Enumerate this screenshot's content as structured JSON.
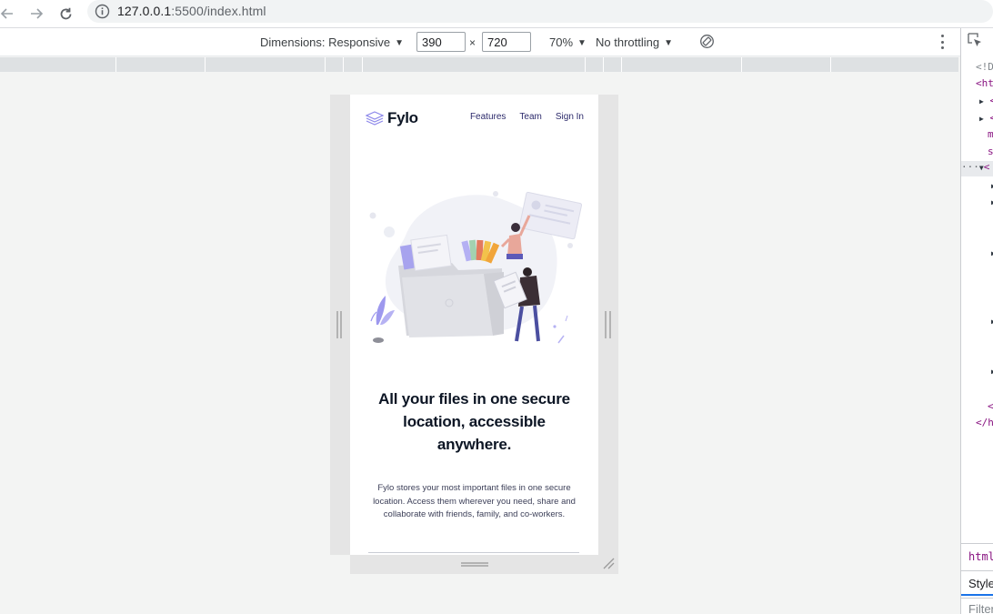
{
  "browser": {
    "url_host": "127.0.0.1",
    "url_path": ":5500/index.html",
    "icons": [
      "back-arrow-icon",
      "forward-arrow-icon",
      "reload-icon",
      "info-icon"
    ]
  },
  "device_toolbar": {
    "dimensions_label": "Dimensions: Responsive",
    "width_value": "390",
    "separator": "×",
    "height_value": "720",
    "zoom_label": "70%",
    "throttle_label": "No throttling"
  },
  "devtools": {
    "lines": [
      "<!D",
      "<ht",
      "<",
      "<",
      "m",
      "s",
      "<",
      "<",
      "</h"
    ],
    "ellipsis": "···",
    "breadcrumb": "html",
    "styles_tab": "Style",
    "filter_placeholder": "Filter"
  },
  "site": {
    "logo_text": "Fylo",
    "nav": [
      "Features",
      "Team",
      "Sign In"
    ],
    "headline": "All your files in one secure location, accessible anywhere.",
    "body": "Fylo stores your most important files in one secure location. Access them wherever you need, share and collaborate with friends, family, and co-workers.",
    "colors": {
      "nav_text": "#2c2a6b",
      "headline_text": "#0c1524",
      "logo_accent": "#7b75e8"
    }
  }
}
